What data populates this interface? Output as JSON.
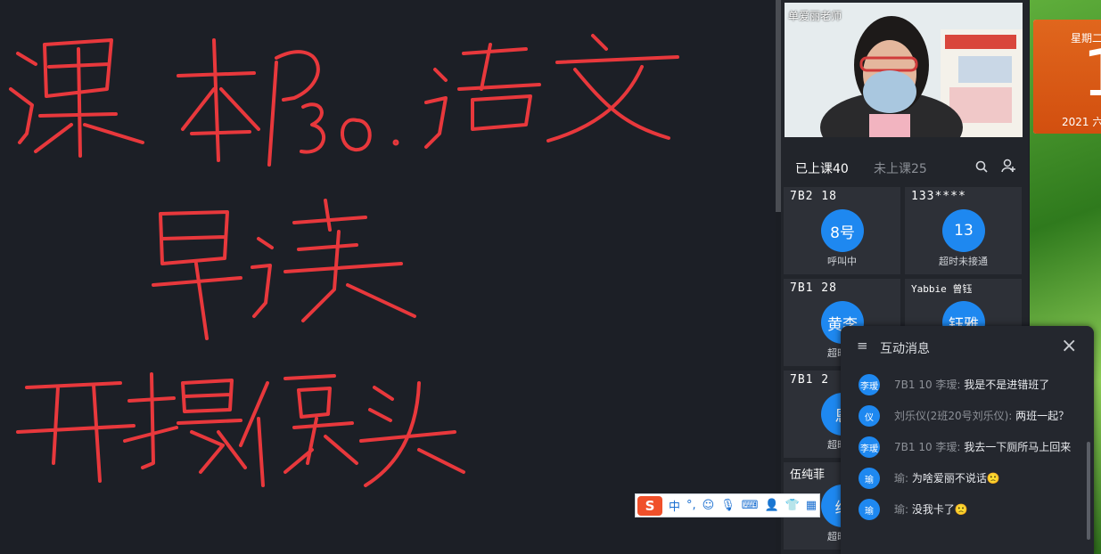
{
  "board": {
    "lines": [
      "课本P30 语文",
      "早读",
      "开摄像头"
    ],
    "ink_color": "#e8383c"
  },
  "video": {
    "teacher_name": "单爱丽老师"
  },
  "tabs": {
    "in_class": "已上课40",
    "not_in_class": "未上课25"
  },
  "students": [
    {
      "title": "7B2 18",
      "avatar": "8号",
      "status": "呼叫中"
    },
    {
      "title": "133****",
      "avatar": "13",
      "status": "超时未接通"
    },
    {
      "title": "7B1 28",
      "avatar": "黄李",
      "status": "超时未"
    },
    {
      "title": "Yabbie 曾钰",
      "avatar": "钰雅",
      "status": ""
    },
    {
      "title": "7B1 2",
      "avatar": "恩",
      "status": "超时未"
    },
    {
      "title": "伍纯菲",
      "avatar": "纯",
      "status": "超时未"
    }
  ],
  "calendar": {
    "weekday": "星期二",
    "day": "1",
    "date": "2021 六"
  },
  "ime": {
    "mode": "中",
    "punct": "°,"
  },
  "chat": {
    "title": "互动消息",
    "messages": [
      {
        "avatar": "李瑷",
        "sender": "7B1 10 李瑷:",
        "text": "我是不是进错班了"
      },
      {
        "avatar": "仪",
        "sender": "刘乐仪(2班20号刘乐仪):",
        "text": "两班一起？"
      },
      {
        "avatar": "李瑷",
        "sender": "7B1 10 李瑷:",
        "text": "我去一下厕所马上回来"
      },
      {
        "avatar": "瑜",
        "sender": "瑜:",
        "text": "为啥爱丽不说话🙁"
      },
      {
        "avatar": "瑜",
        "sender": "瑜:",
        "text": "没我卡了🙁"
      }
    ]
  },
  "colors": {
    "accent": "#1e88f0",
    "ink": "#e8383c",
    "calendar": "#d9571a"
  }
}
